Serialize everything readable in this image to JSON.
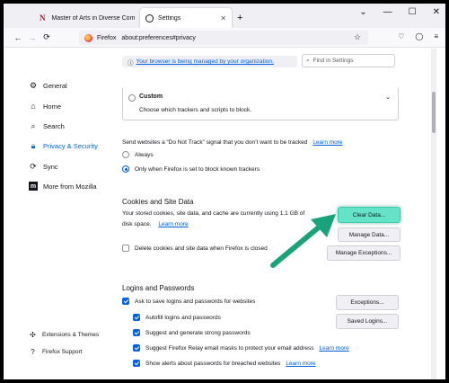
{
  "tabs": [
    {
      "title": "Master of Arts in Diverse Comm",
      "icon": "n-logo-icon"
    },
    {
      "title": "Settings",
      "icon": "gear-icon",
      "active": true
    }
  ],
  "new_tab_symbol": "+",
  "window_controls": {
    "minimize": "—",
    "maximize": "☐",
    "close": "✕",
    "tab_list": "⌄"
  },
  "nav": {
    "back": "←",
    "forward": "→",
    "reload": "⟳",
    "brand": "Firefox",
    "url": "about:preferences#privacy",
    "star": "☆"
  },
  "toolbar_icons": [
    "pocket-icon",
    "account-icon",
    "menu-icon"
  ],
  "sidebar": {
    "items": [
      {
        "label": "General",
        "icon": "gear-icon"
      },
      {
        "label": "Home",
        "icon": "home-icon"
      },
      {
        "label": "Search",
        "icon": "search-icon"
      },
      {
        "label": "Privacy & Security",
        "icon": "lock-icon",
        "active": true
      },
      {
        "label": "Sync",
        "icon": "sync-icon"
      },
      {
        "label": "More from Mozilla",
        "icon": "mozilla-icon"
      }
    ],
    "footer": [
      {
        "label": "Extensions & Themes",
        "icon": "puzzle-icon"
      },
      {
        "label": "Firefox Support",
        "icon": "help-icon"
      }
    ]
  },
  "main": {
    "policy_notice": "Your browser is being managed by your organization.",
    "find_placeholder": "Find in Settings",
    "custom": {
      "title": "Custom",
      "description": "Choose which trackers and scripts to block."
    },
    "dnt": {
      "text": "Send websites a “Do Not Track” signal that you don’t want to be tracked",
      "learn_more": "Learn more",
      "options": [
        "Always",
        "Only when Firefox is set to block known trackers"
      ],
      "selected": 1
    },
    "cookies": {
      "title": "Cookies and Site Data",
      "line1": "Your stored cookies, site data, and cache are currently using 1.1 GB of",
      "line2": "disk space.",
      "learn_more": "Learn more",
      "buttons": [
        "Clear Data...",
        "Manage Data...",
        "Manage Exceptions..."
      ],
      "delete_on_close": "Delete cookies and site data when Firefox is closed"
    },
    "logins": {
      "title": "Logins and Passwords",
      "ask": "Ask to save logins and passwords for websites",
      "options": [
        {
          "label": "Autofill logins and passwords",
          "link": ""
        },
        {
          "label": "Suggest and generate strong passwords",
          "link": ""
        },
        {
          "label": "Suggest Firefox Relay email masks to protect your email address",
          "link": "Learn more"
        },
        {
          "label": "Show alerts about passwords for breached websites",
          "link": "Learn more"
        }
      ],
      "buttons": [
        "Exceptions...",
        "Saved Logins..."
      ]
    }
  },
  "annotation": {
    "arrow_color": "#1aa37a"
  }
}
